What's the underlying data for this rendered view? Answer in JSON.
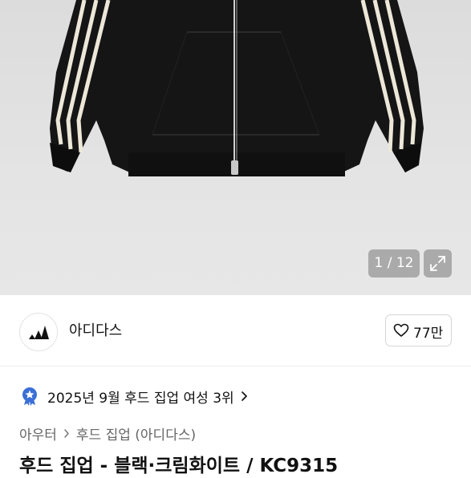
{
  "gallery": {
    "counter": "1 / 12"
  },
  "brand": {
    "name": "아디다스"
  },
  "like": {
    "count": "77만"
  },
  "ranking": {
    "text": "2025년 9월 후드 집업 여성 3위"
  },
  "breadcrumb": {
    "items": [
      "아우터",
      "후드 집업 (아디다스)"
    ]
  },
  "product": {
    "title": "후드 집업 - 블랙·크림화이트 / KC9315"
  },
  "icons": {
    "expand": "expand-icon",
    "heart": "heart-icon",
    "medal": "ranking-medal-icon",
    "chevron": "chevron-right-icon",
    "brand_logo": "adidas-logo"
  },
  "colors": {
    "jacket": "#151515",
    "stripe": "#ece7d8",
    "medal": "#3b6fd6"
  }
}
